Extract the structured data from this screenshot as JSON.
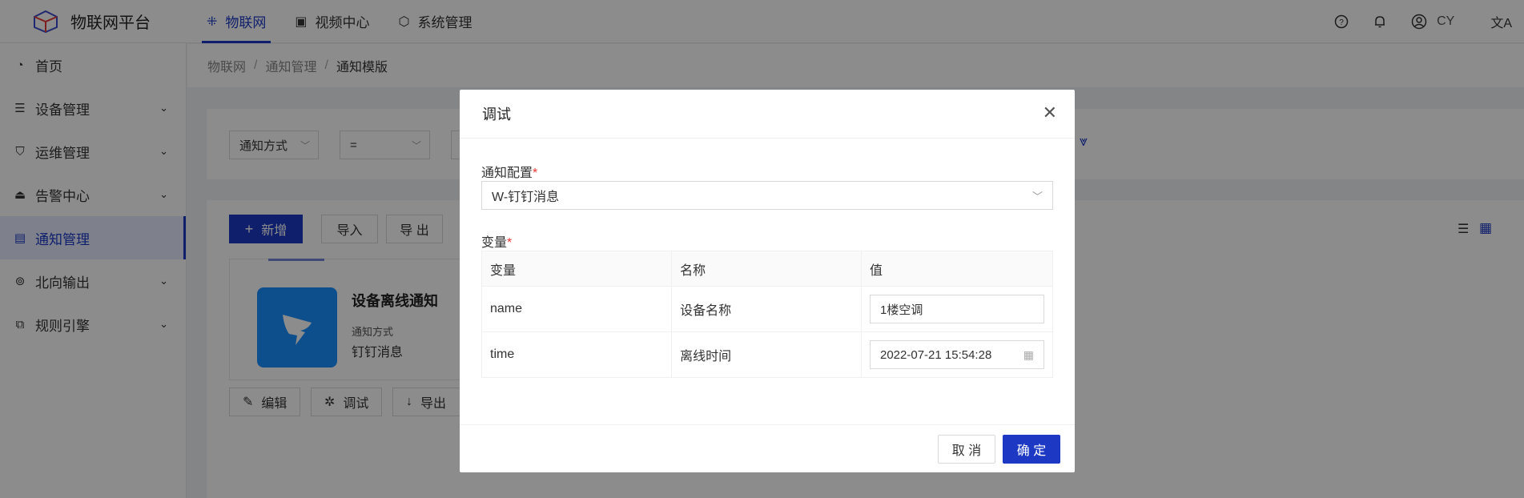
{
  "header": {
    "title": "物联网平台",
    "nav": [
      {
        "label": "物联网",
        "icon": "iot-icon"
      },
      {
        "label": "视频中心",
        "icon": "video-icon"
      },
      {
        "label": "系统管理",
        "icon": "system-icon"
      }
    ],
    "user": "CY",
    "colors": {
      "accent": "#1d39c4"
    }
  },
  "sidebar": {
    "items": [
      {
        "label": "首页",
        "icon": "pie-chart-icon"
      },
      {
        "label": "设备管理",
        "icon": "device-icon"
      },
      {
        "label": "运维管理",
        "icon": "ops-icon"
      },
      {
        "label": "告警中心",
        "icon": "alarm-icon"
      },
      {
        "label": "通知管理",
        "icon": "notice-icon"
      },
      {
        "label": "北向输出",
        "icon": "output-icon"
      },
      {
        "label": "规则引擎",
        "icon": "rule-icon"
      }
    ]
  },
  "breadcrumb": [
    "物联网",
    "通知管理",
    "通知模版"
  ],
  "search": {
    "field": "通知方式",
    "operator": "="
  },
  "toolbar": {
    "add_label": "新增",
    "import_label": "导入",
    "export_label": "导 出"
  },
  "template_card": {
    "name": "设备离线通知",
    "type_label": "通知方式",
    "type_value": "钉钉消息",
    "actions": [
      "编辑",
      "调试",
      "导出"
    ]
  },
  "modal": {
    "title": "调试",
    "config_label": "通知配置",
    "config_value": "W-钉钉消息",
    "vars_label": "变量",
    "columns": [
      "变量",
      "名称",
      "值"
    ],
    "rows": [
      {
        "var": "name",
        "name": "设备名称",
        "value": "1楼空调"
      },
      {
        "var": "time",
        "name": "离线时间",
        "value": "2022-07-21 15:54:28"
      }
    ],
    "cancel_label": "取 消",
    "ok_label": "确 定"
  }
}
